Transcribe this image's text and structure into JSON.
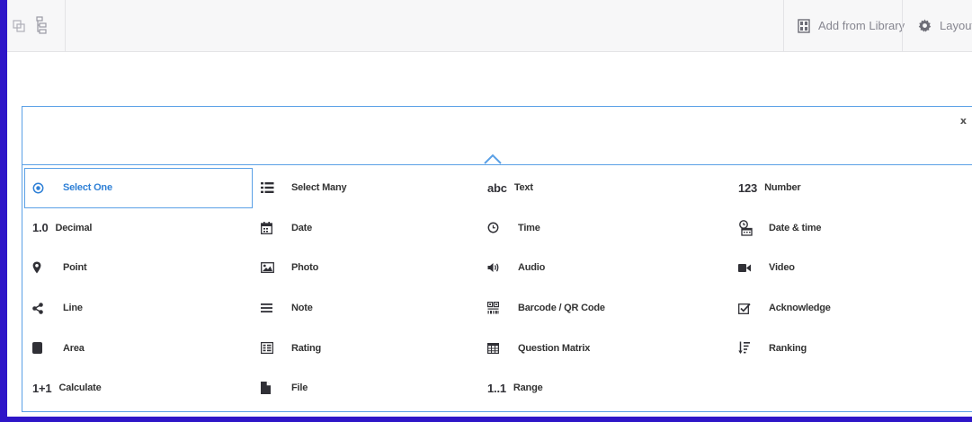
{
  "toolbar": {
    "add_library_label": "Add from Library",
    "layout_label": "Layout &",
    "icons": [
      "clone-icon",
      "tree-icon",
      "library-icon",
      "gear-icon"
    ]
  },
  "panel": {
    "close_label": "x",
    "question_types": [
      {
        "label": "Select One",
        "icon": "radio-icon",
        "selected": true
      },
      {
        "label": "Select Many",
        "icon": "list-icon"
      },
      {
        "label": "Text",
        "icon_text": "abc"
      },
      {
        "label": "Number",
        "icon_text": "123"
      },
      {
        "label": "Decimal",
        "icon_text": "1.0"
      },
      {
        "label": "Date",
        "icon": "calendar-icon"
      },
      {
        "label": "Time",
        "icon": "clock-icon"
      },
      {
        "label": "Date & time",
        "icon": "datetime-icon"
      },
      {
        "label": "Point",
        "icon": "map-pin-icon"
      },
      {
        "label": "Photo",
        "icon": "photo-icon"
      },
      {
        "label": "Audio",
        "icon": "audio-icon"
      },
      {
        "label": "Video",
        "icon": "video-icon"
      },
      {
        "label": "Line",
        "icon": "share-icon"
      },
      {
        "label": "Note",
        "icon": "note-icon"
      },
      {
        "label": "Barcode / QR Code",
        "icon": "qr-icon"
      },
      {
        "label": "Acknowledge",
        "icon": "checkbox-icon"
      },
      {
        "label": "Area",
        "icon": "area-icon"
      },
      {
        "label": "Rating",
        "icon": "rating-icon"
      },
      {
        "label": "Question Matrix",
        "icon": "table-icon"
      },
      {
        "label": "Ranking",
        "icon": "ranking-icon"
      },
      {
        "label": "Calculate",
        "icon_text": "1+1"
      },
      {
        "label": "File",
        "icon": "file-icon"
      },
      {
        "label": "Range",
        "icon_text": "1..1"
      }
    ]
  },
  "colors": {
    "frame": "#2e16c8",
    "accent": "#5aa0e6",
    "selected_text": "#2f80d6",
    "toolbar_bg": "#f7f7f8"
  }
}
